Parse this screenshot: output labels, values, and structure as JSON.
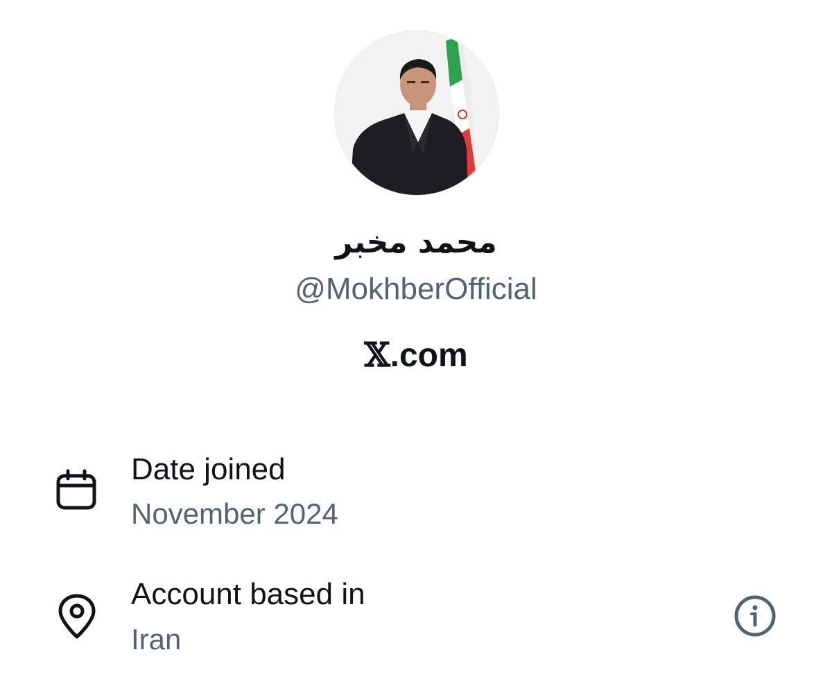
{
  "profile": {
    "display_name": "محمد مخبر",
    "handle": "@MokhberOfficial",
    "avatar_alt": "profile-photo"
  },
  "brand": {
    "mark": "𝕏",
    "suffix": ".com"
  },
  "details": {
    "date_joined": {
      "icon": "calendar-icon",
      "label": "Date joined",
      "value": "November 2024"
    },
    "account_based_in": {
      "icon": "location-pin-icon",
      "label": "Account based in",
      "value": "Iran",
      "action_icon": "info-icon"
    }
  },
  "colors": {
    "primary_text": "#0f1419",
    "secondary_text": "#536471",
    "background": "#ffffff"
  }
}
